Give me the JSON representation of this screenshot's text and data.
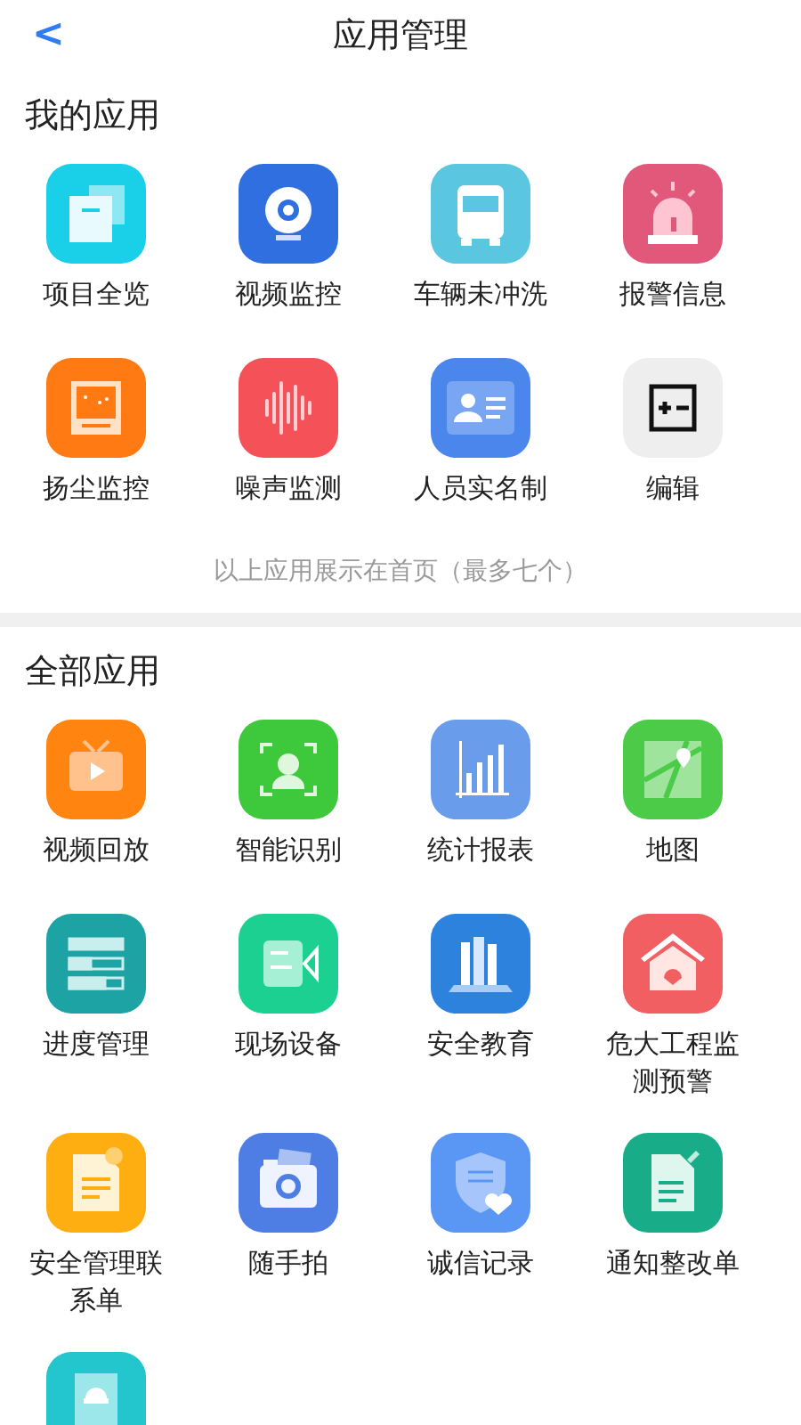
{
  "header": {
    "back": "<",
    "title": "应用管理"
  },
  "my_apps": {
    "title": "我的应用",
    "items": [
      {
        "kind": "layers",
        "label": "项目全览"
      },
      {
        "kind": "webcam",
        "label": "视频监控"
      },
      {
        "kind": "truck",
        "label": "车辆未冲洗"
      },
      {
        "kind": "siren",
        "label": "报警信息"
      },
      {
        "kind": "monitor",
        "label": "扬尘监控"
      },
      {
        "kind": "soundwave",
        "label": "噪声监测"
      },
      {
        "kind": "idcard",
        "label": "人员实名制"
      },
      {
        "kind": "edit",
        "label": "编辑"
      }
    ],
    "note": "以上应用展示在首页（最多七个）"
  },
  "all_apps": {
    "title": "全部应用",
    "items": [
      {
        "kind": "tv",
        "label": "视频回放"
      },
      {
        "kind": "facescan",
        "label": "智能识别"
      },
      {
        "kind": "barchart",
        "label": "统计报表"
      },
      {
        "kind": "map",
        "label": "地图"
      },
      {
        "kind": "progress",
        "label": "进度管理"
      },
      {
        "kind": "videocam",
        "label": "现场设备"
      },
      {
        "kind": "books",
        "label": "安全教育"
      },
      {
        "kind": "house",
        "label": "危大工程监测预警"
      },
      {
        "kind": "doc",
        "label": "安全管理联系单"
      },
      {
        "kind": "camera",
        "label": "随手拍"
      },
      {
        "kind": "shield",
        "label": "诚信记录"
      },
      {
        "kind": "docpen",
        "label": "通知整改单"
      },
      {
        "kind": "helmet"
      }
    ]
  }
}
